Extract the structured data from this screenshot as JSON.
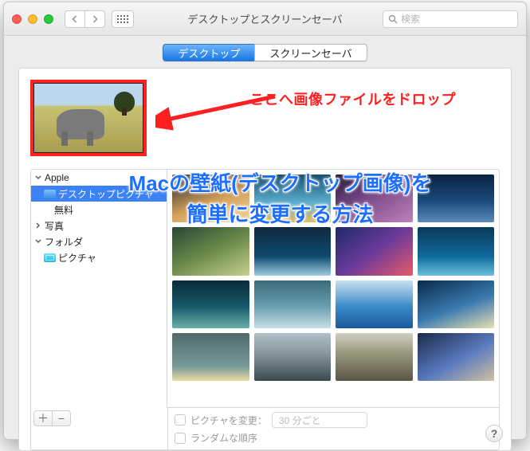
{
  "window": {
    "title": "デスクトップとスクリーンセーバ",
    "search_placeholder": "検索"
  },
  "tabs": {
    "desktop": "デスクトップ",
    "screensaver": "スクリーンセーバ"
  },
  "preview": {
    "name": "象"
  },
  "sidebar": {
    "apple": "Apple",
    "desktop_pictures": "デスクトップピクチャ",
    "solid_colors": "無料",
    "photos": "写真",
    "folders": "フォルダ",
    "pictures": "ピクチャ"
  },
  "options": {
    "change_picture_label": "ピクチャを変更：",
    "change_interval": "30 分ごと",
    "random_order_label": "ランダムな順序"
  },
  "buttons": {
    "add": "＋",
    "remove": "−",
    "help": "?"
  },
  "annotations": {
    "drop_hint": "ここへ画像ファイルをドロップ",
    "title_overlay": "Macの壁紙(デスクトップ画像)を\n簡単に変更する方法"
  },
  "thumbnails": [
    "linear-gradient(160deg,#1a1f2f,#d4a05a 55%,#f0d8a0)",
    "linear-gradient(#17506e,#5fb0d0 60%,#e8ba5a)",
    "linear-gradient(150deg,#2a1a3a,#7a4a8a 45%,#c080b8)",
    "linear-gradient(#0b2342,#1a4a7a 55%,#5a8bba)",
    "linear-gradient(155deg,#2a4636,#6a8a4a 50%,#c8d090)",
    "linear-gradient(#10293e,#0e4a6e 60%,#a0cce0)",
    "linear-gradient(145deg,#1e2a6a,#6a3a9a 50%,#e85a6a)",
    "linear-gradient(#0a3a5a,#0f6a9a 60%,#6ac0e0)",
    "linear-gradient(#0a2a3a,#185a6a 55%,#6ab0a8)",
    "linear-gradient(#3a6a7a,#6aa0b0 55%,#c8e0e8)",
    "linear-gradient(#c8e0f0,#3a8ac8 55%,#1a5a9a)",
    "linear-gradient(160deg,#0a2a4a,#3a7ab0 55%,#e8e0b0)",
    "linear-gradient(#506a6a,#789a9a 70%,#eadba0)",
    "linear-gradient(#b0c0c8,#8a9aa0 40%,#3a4a50)",
    "linear-gradient(#d0d0c0,#9a9a80 40%,#5a5545)",
    "linear-gradient(150deg,#1a2a4a,#5a7ac0 55%,#d0c0a0)"
  ]
}
